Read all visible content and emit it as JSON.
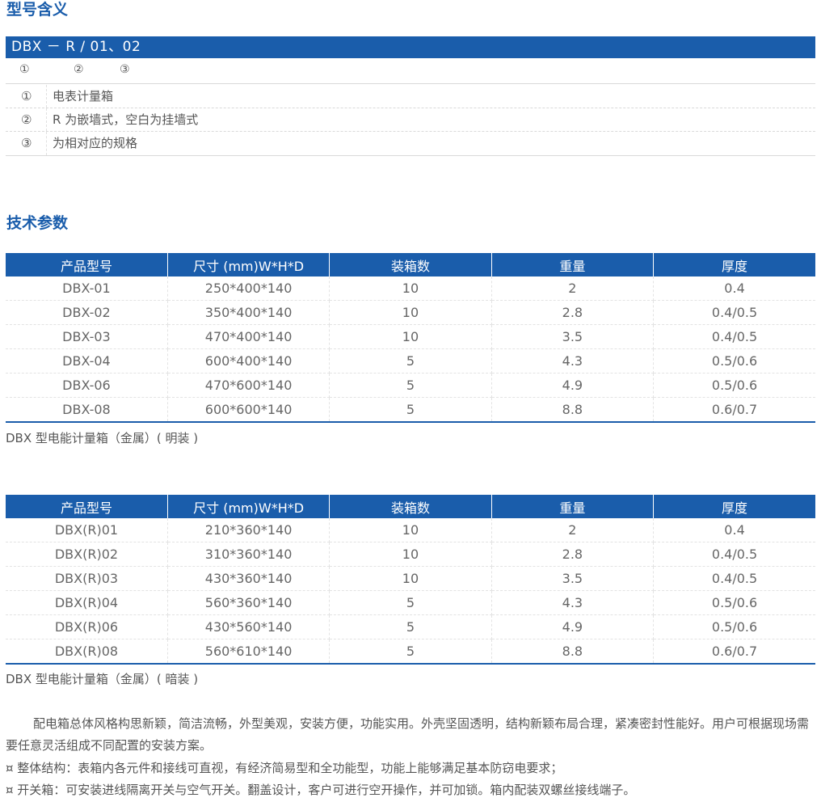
{
  "model_section": {
    "title": "型号含义",
    "code": "DBX － R / 01、02",
    "markers": [
      "①",
      "②",
      "③"
    ],
    "meanings": [
      {
        "num": "①",
        "text": "电表计量箱"
      },
      {
        "num": "②",
        "text": "R 为嵌墙式，空白为挂墙式"
      },
      {
        "num": "③",
        "text": "为相对应的规格"
      }
    ]
  },
  "tech_section": {
    "title": "技术参数",
    "columns": [
      "产品型号",
      "尺寸 (mm)W*H*D",
      "装箱数",
      "重量",
      "厚度"
    ],
    "table1": {
      "rows": [
        [
          "DBX-01",
          "250*400*140",
          "10",
          "2",
          "0.4"
        ],
        [
          "DBX-02",
          "350*400*140",
          "10",
          "2.8",
          "0.4/0.5"
        ],
        [
          "DBX-03",
          "470*400*140",
          "10",
          "3.5",
          "0.4/0.5"
        ],
        [
          "DBX-04",
          "600*400*140",
          "5",
          "4.3",
          "0.5/0.6"
        ],
        [
          "DBX-06",
          "470*600*140",
          "5",
          "4.9",
          "0.5/0.6"
        ],
        [
          "DBX-08",
          "600*600*140",
          "5",
          "8.8",
          "0.6/0.7"
        ]
      ],
      "caption": "DBX 型电能计量箱（金属）( 明装 )"
    },
    "table2": {
      "rows": [
        [
          "DBX(R)01",
          "210*360*140",
          "10",
          "2",
          "0.4"
        ],
        [
          "DBX(R)02",
          "310*360*140",
          "10",
          "2.8",
          "0.4/0.5"
        ],
        [
          "DBX(R)03",
          "430*360*140",
          "10",
          "3.5",
          "0.4/0.5"
        ],
        [
          "DBX(R)04",
          "560*360*140",
          "5",
          "4.3",
          "0.5/0.6"
        ],
        [
          "DBX(R)06",
          "430*560*140",
          "5",
          "4.9",
          "0.5/0.6"
        ],
        [
          "DBX(R)08",
          "560*610*140",
          "5",
          "8.8",
          "0.6/0.7"
        ]
      ],
      "caption": "DBX 型电能计量箱（金属）( 暗装 )"
    }
  },
  "description": {
    "paragraph": "配电箱总体风格构思新颖，简洁流畅，外型美观，安装方便，功能实用。外壳坚固透明，结构新颖布局合理，紧凑密封性能好。用户可根据现场需要任意灵活组成不同配置的安装方案。",
    "bullets": [
      "¤ 整体结构：表箱内各元件和接线可直视，有经济简易型和全功能型，功能上能够满足基本防窃电要求；",
      "¤ 开关箱：可安装进线隔离开关与空气开关。翻盖设计，客户可进行空开操作，并可加锁。箱内配装双螺丝接线端子。"
    ]
  },
  "colors": {
    "accent": "#1a5dab",
    "text": "#555555"
  }
}
